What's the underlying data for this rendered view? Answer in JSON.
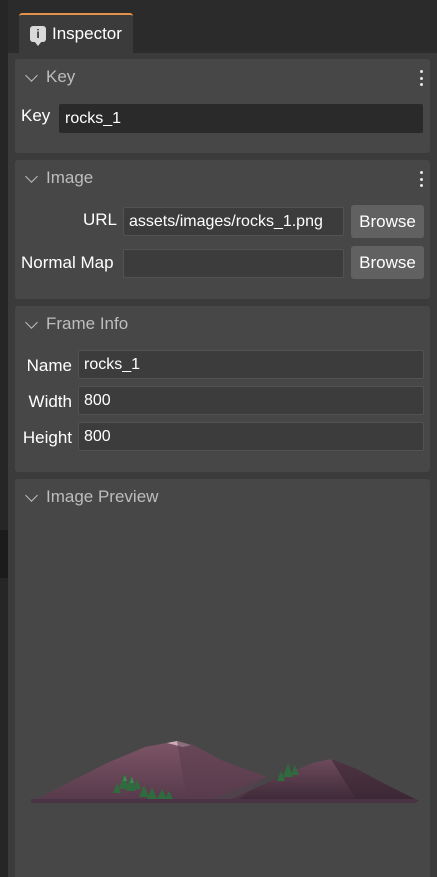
{
  "tab": {
    "icon": "info-bubble-icon",
    "label": "Inspector"
  },
  "sections": {
    "key": {
      "title": "Key",
      "fields": {
        "key_label": "Key",
        "key_value": "rocks_1"
      }
    },
    "image": {
      "title": "Image",
      "url_label": "URL",
      "url_value": "assets/images/rocks_1.png",
      "normal_map_label": "Normal Map",
      "normal_map_value": "",
      "browse_label": "Browse"
    },
    "frame_info": {
      "title": "Frame Info",
      "name_label": "Name",
      "name_value": "rocks_1",
      "width_label": "Width",
      "width_value": "800",
      "height_label": "Height",
      "height_value": "800"
    },
    "image_preview": {
      "title": "Image Preview",
      "image": "mountain-rocks-preview"
    }
  },
  "colors": {
    "tab_accent": "#e4924a",
    "panel_bg": "#3b3b3b",
    "section_bg": "#474747",
    "mountain_main": "#6b4757",
    "mountain_shadow": "#3f2b38",
    "tree_green": "#2f6b3e"
  }
}
